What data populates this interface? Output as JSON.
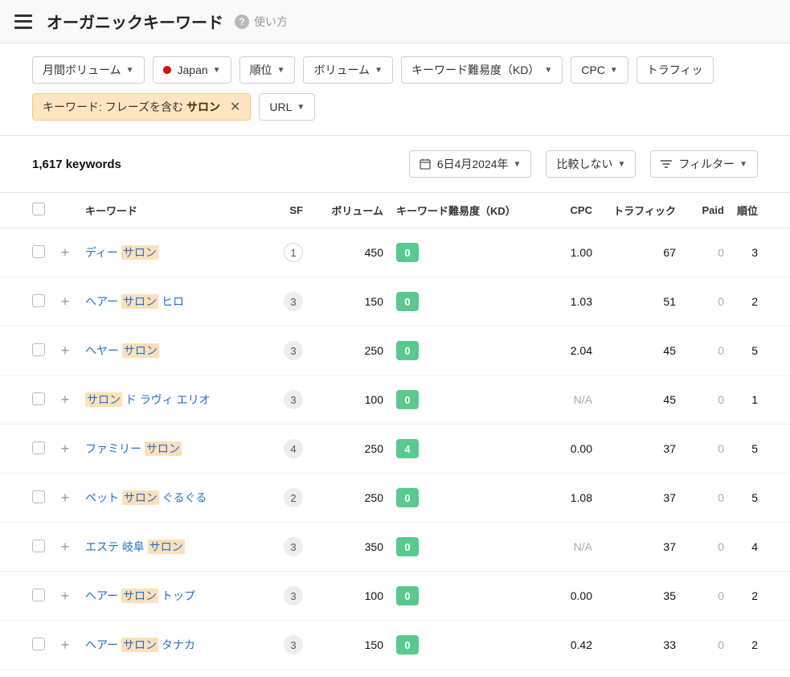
{
  "header": {
    "title": "オーガニックキーワード",
    "help_label": "使い方"
  },
  "filters": {
    "volume": "月間ボリューム",
    "country": "Japan",
    "position": "順位",
    "volume2": "ボリューム",
    "kd": "キーワード難易度（KD）",
    "cpc": "CPC",
    "traffic": "トラフィッ",
    "active_prefix": "キーワード: フレーズを含む ",
    "active_value": "サロン",
    "url": "URL"
  },
  "toolbar": {
    "count": "1,617 keywords",
    "date": "6日4月2024年",
    "compare": "比較しない",
    "filter": "フィルター"
  },
  "columns": {
    "keyword": "キーワード",
    "sf": "SF",
    "volume": "ボリューム",
    "kd": "キーワード難易度（KD）",
    "cpc": "CPC",
    "traffic": "トラフィック",
    "paid": "Paid",
    "position": "順位"
  },
  "highlight": "サロン",
  "rows": [
    {
      "keyword": "ディー サロン",
      "sf": "1",
      "sf_white": true,
      "volume": "450",
      "kd": "0",
      "cpc": "1.00",
      "cpc_muted": false,
      "traffic": "67",
      "paid": "0",
      "position": "3"
    },
    {
      "keyword": "ヘアー サロン ヒロ",
      "sf": "3",
      "sf_white": false,
      "volume": "150",
      "kd": "0",
      "cpc": "1.03",
      "cpc_muted": false,
      "traffic": "51",
      "paid": "0",
      "position": "2"
    },
    {
      "keyword": "ヘヤー サロン",
      "sf": "3",
      "sf_white": false,
      "volume": "250",
      "kd": "0",
      "cpc": "2.04",
      "cpc_muted": false,
      "traffic": "45",
      "paid": "0",
      "position": "5"
    },
    {
      "keyword": "サロン ド ラヴィ エリオ",
      "sf": "3",
      "sf_white": false,
      "volume": "100",
      "kd": "0",
      "cpc": "N/A",
      "cpc_muted": true,
      "traffic": "45",
      "paid": "0",
      "position": "1"
    },
    {
      "keyword": "ファミリー サロン",
      "sf": "4",
      "sf_white": false,
      "volume": "250",
      "kd": "4",
      "cpc": "0.00",
      "cpc_muted": false,
      "traffic": "37",
      "paid": "0",
      "position": "5"
    },
    {
      "keyword": "ペット サロン ぐるぐる",
      "sf": "2",
      "sf_white": false,
      "volume": "250",
      "kd": "0",
      "cpc": "1.08",
      "cpc_muted": false,
      "traffic": "37",
      "paid": "0",
      "position": "5"
    },
    {
      "keyword": "エステ 岐阜 サロン",
      "sf": "3",
      "sf_white": false,
      "volume": "350",
      "kd": "0",
      "cpc": "N/A",
      "cpc_muted": true,
      "traffic": "37",
      "paid": "0",
      "position": "4"
    },
    {
      "keyword": "ヘアー サロン トップ",
      "sf": "3",
      "sf_white": false,
      "volume": "100",
      "kd": "0",
      "cpc": "0.00",
      "cpc_muted": false,
      "traffic": "35",
      "paid": "0",
      "position": "2"
    },
    {
      "keyword": "ヘアー サロン タナカ",
      "sf": "3",
      "sf_white": false,
      "volume": "150",
      "kd": "0",
      "cpc": "0.42",
      "cpc_muted": false,
      "traffic": "33",
      "paid": "0",
      "position": "2"
    }
  ]
}
